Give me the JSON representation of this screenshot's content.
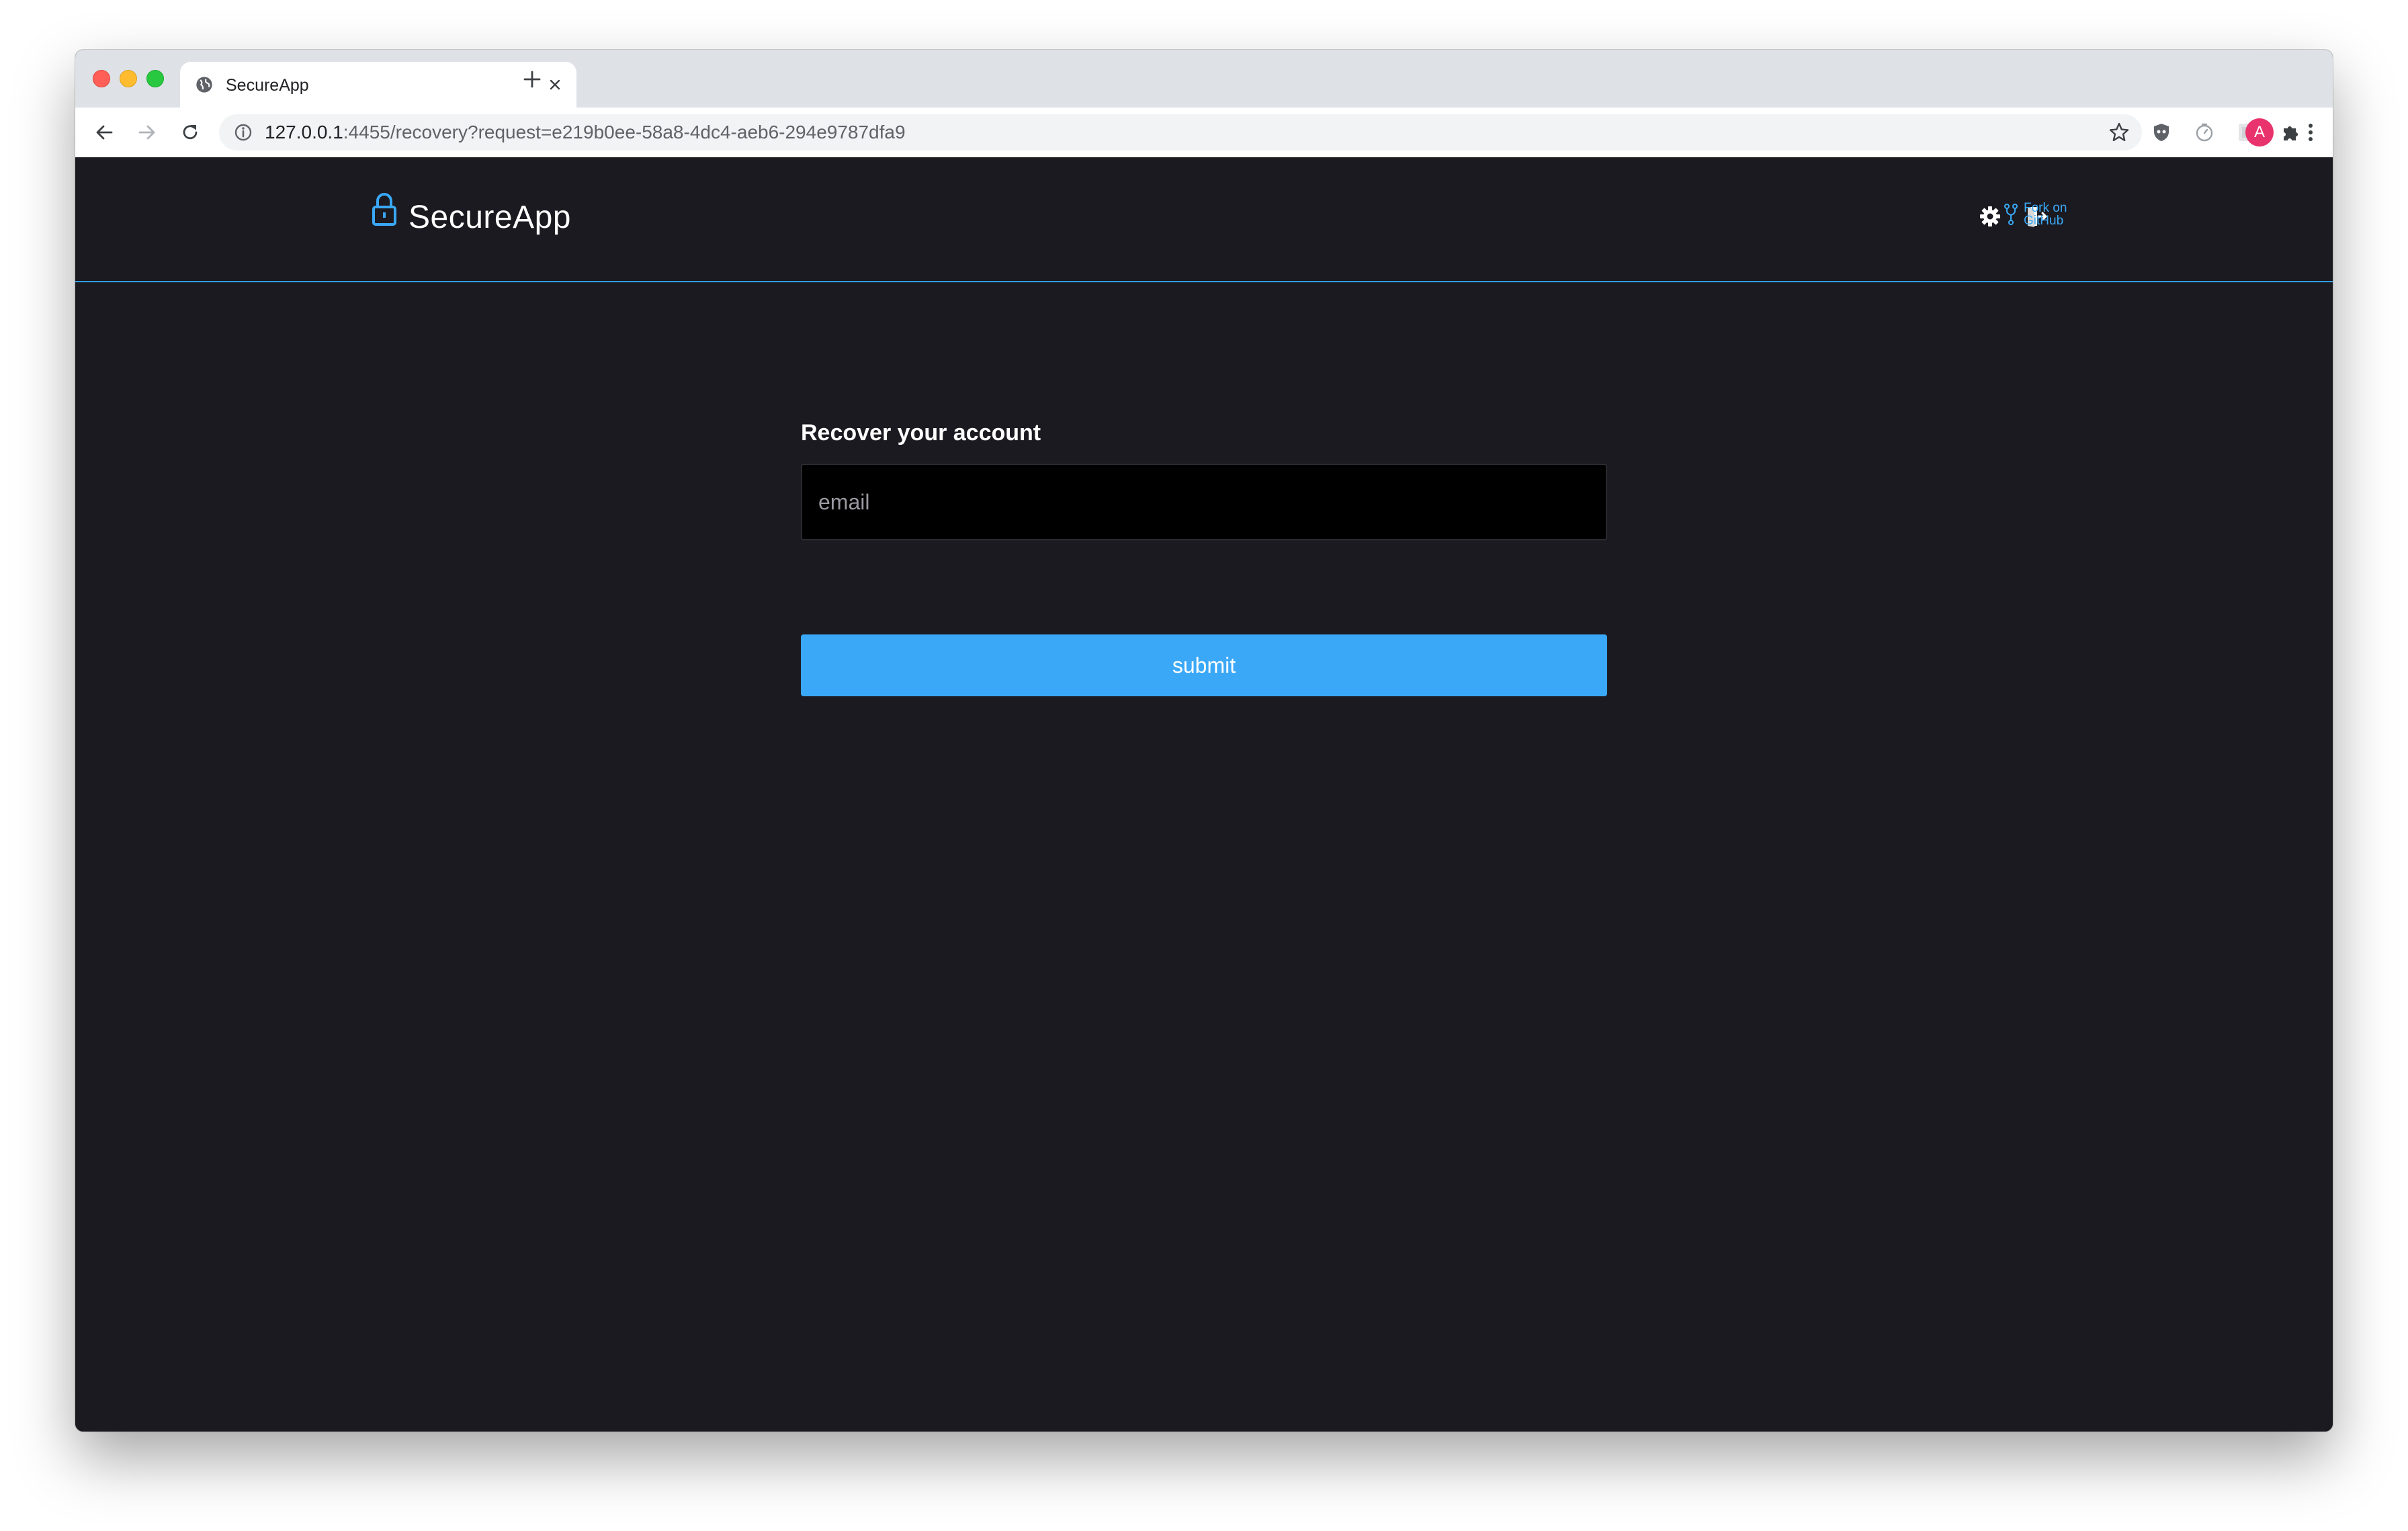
{
  "browser": {
    "tab": {
      "title": "SecureApp"
    },
    "url": {
      "host": "127.0.0.1",
      "rest": ":4455/recovery?request=e219b0ee-58a8-4dc4-aeb6-294e9787dfa9"
    },
    "profile_initial": "A"
  },
  "app": {
    "brand": "SecureApp",
    "fork_link": {
      "line1": "Fork on",
      "line2": "GitHub"
    },
    "accent_color": "#3aa8f7"
  },
  "recovery_form": {
    "title": "Recover your account",
    "email_placeholder": "email",
    "email_value": "",
    "submit_label": "submit"
  }
}
